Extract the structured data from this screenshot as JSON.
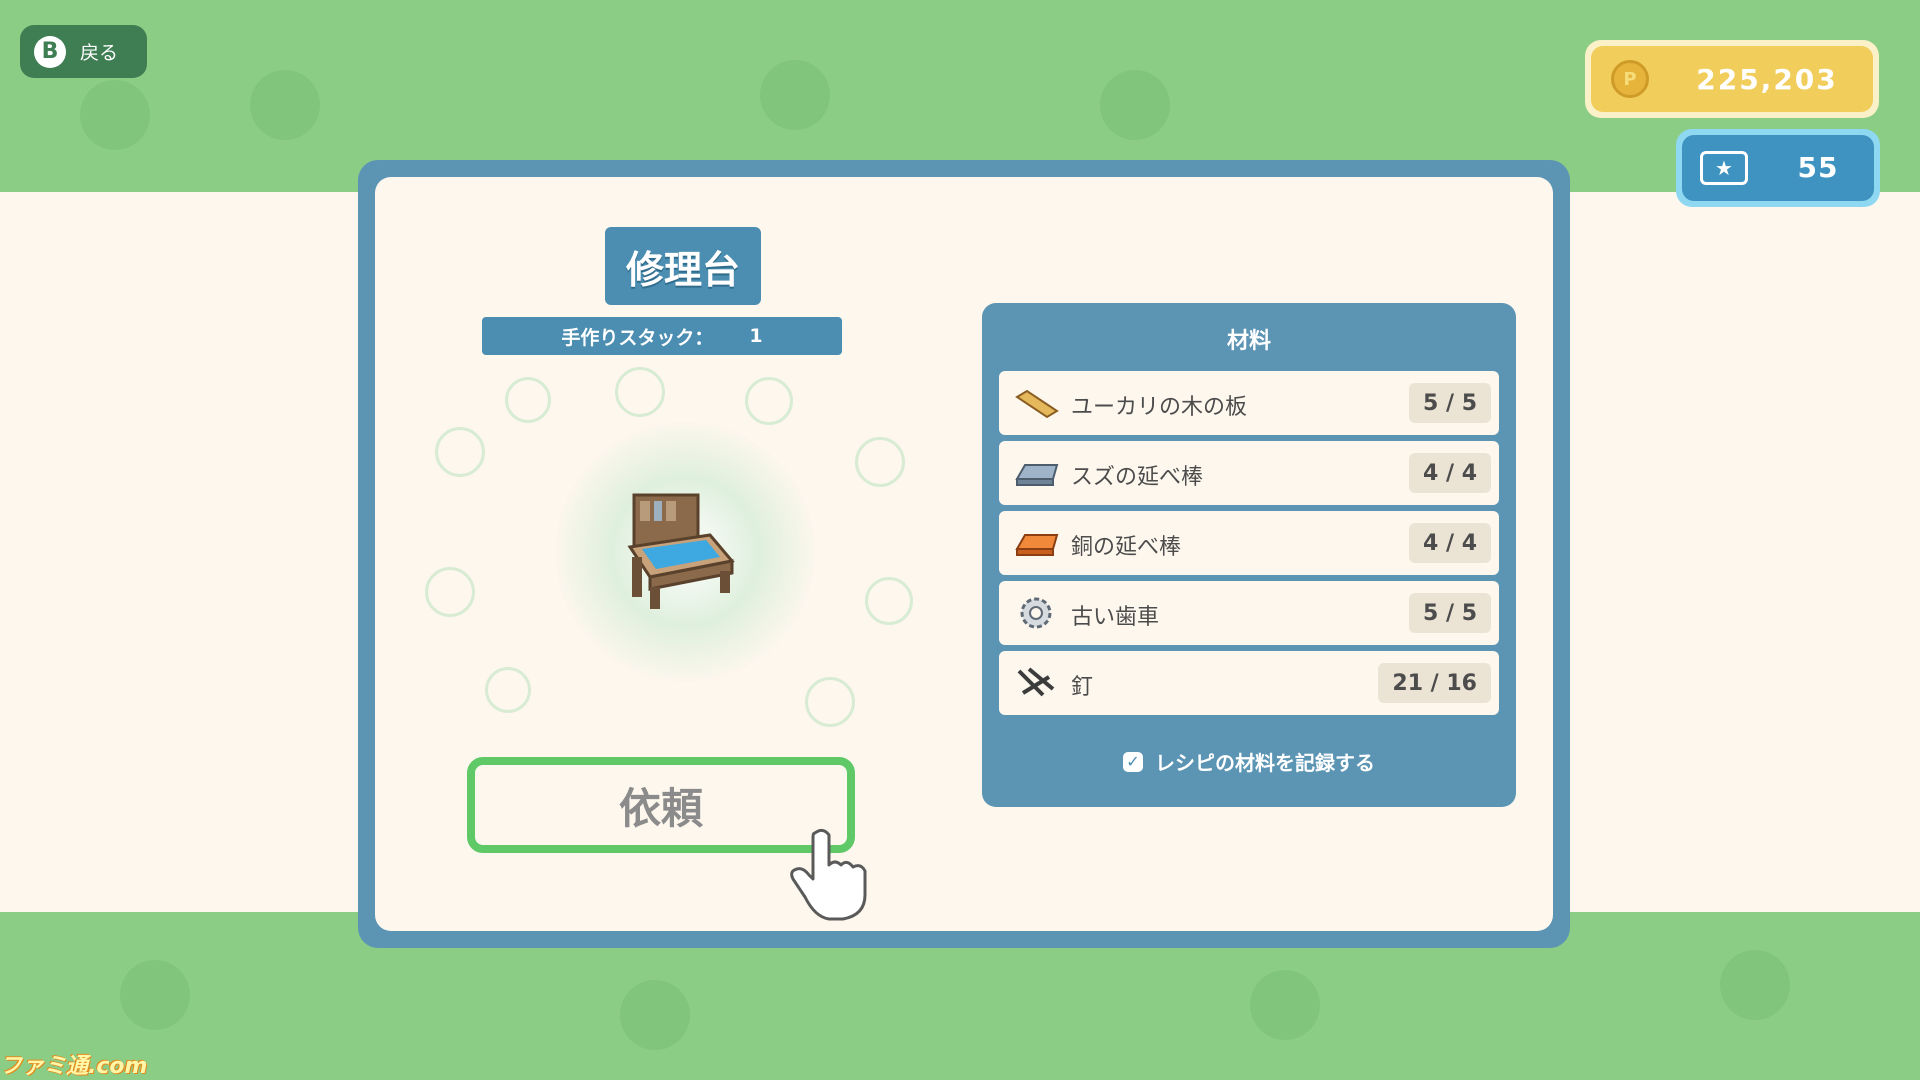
{
  "back_button": {
    "key": "B",
    "label": "戻る"
  },
  "currency": {
    "coins": "225,203",
    "tickets": "55"
  },
  "item": {
    "title": "修理台",
    "stack_label": "手作りスタック：",
    "stack_value": "1"
  },
  "request_button": {
    "label": "依頼"
  },
  "materials": {
    "header": "材料",
    "items": [
      {
        "name": "ユーカリの木の板",
        "count": "5 / 5",
        "icon": "wood-plank-icon"
      },
      {
        "name": "スズの延べ棒",
        "count": "4 / 4",
        "icon": "tin-ingot-icon"
      },
      {
        "name": "銅の延べ棒",
        "count": "4 / 4",
        "icon": "copper-ingot-icon"
      },
      {
        "name": "古い歯車",
        "count": "5 / 5",
        "icon": "gear-icon"
      },
      {
        "name": "釘",
        "count": "21 / 16",
        "icon": "nails-icon"
      }
    ],
    "record_label": "レシピの材料を記録する",
    "record_checked": true
  },
  "watermark": "ファミ通.com",
  "colors": {
    "background_green": "#8ccd86",
    "panel_blue": "#5c95b4",
    "cream": "#fdf7ee",
    "button_green": "#5fc967",
    "coin_yellow": "#f1cd5b",
    "ticket_blue": "#3e93c0"
  }
}
